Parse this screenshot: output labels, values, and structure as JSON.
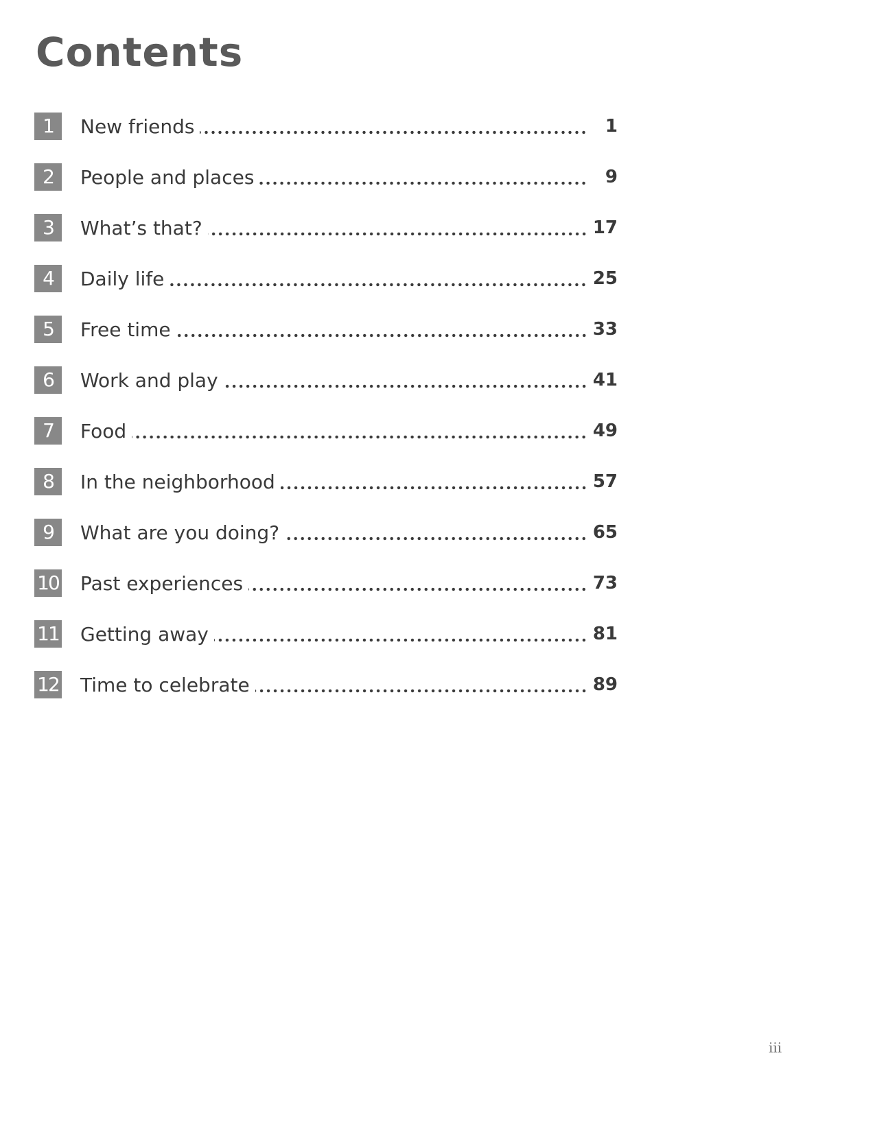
{
  "page": {
    "title": "Contents",
    "folio": "iii"
  },
  "toc": {
    "entries": [
      {
        "unit": "1",
        "title": "New friends",
        "page": "1"
      },
      {
        "unit": "2",
        "title": "People and places",
        "page": "9"
      },
      {
        "unit": "3",
        "title": "What’s that?",
        "page": "17"
      },
      {
        "unit": "4",
        "title": "Daily life",
        "page": "25"
      },
      {
        "unit": "5",
        "title": "Free time",
        "page": "33"
      },
      {
        "unit": "6",
        "title": "Work and play",
        "page": "41"
      },
      {
        "unit": "7",
        "title": "Food",
        "page": "49"
      },
      {
        "unit": "8",
        "title": "In the neighborhood",
        "page": "57"
      },
      {
        "unit": "9",
        "title": "What are you doing?",
        "page": "65"
      },
      {
        "unit": "10",
        "title": "Past experiences",
        "page": "73"
      },
      {
        "unit": "11",
        "title": "Getting away",
        "page": "81"
      },
      {
        "unit": "12",
        "title": "Time to celebrate",
        "page": "89"
      }
    ]
  },
  "colors": {
    "badge": "#888888",
    "title": "#5a5a5a",
    "text": "#3a3a3a"
  }
}
